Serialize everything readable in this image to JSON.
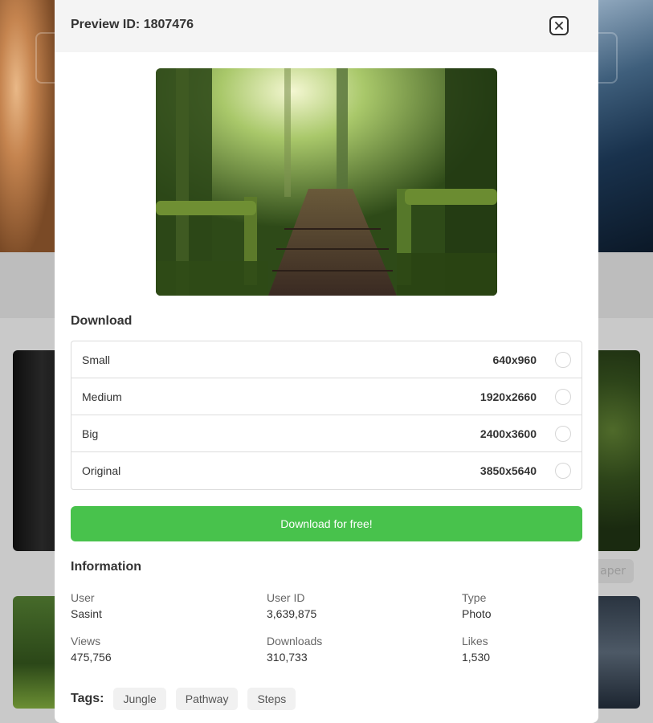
{
  "modal": {
    "title": "Preview ID: 1807476",
    "preview_alt": "Wooden moss-covered pathway through a jungle forest"
  },
  "download": {
    "title": "Download",
    "sizes": [
      {
        "name": "Small",
        "dimensions": "640x960"
      },
      {
        "name": "Medium",
        "dimensions": "1920x2660"
      },
      {
        "name": "Big",
        "dimensions": "2400x3600"
      },
      {
        "name": "Original",
        "dimensions": "3850x5640"
      }
    ],
    "button_label": "Download for free!",
    "button_color": "#48c24c"
  },
  "information": {
    "title": "Information",
    "fields": [
      {
        "label": "User",
        "value": "Sasint"
      },
      {
        "label": "User ID",
        "value": "3,639,875"
      },
      {
        "label": "Type",
        "value": "Photo"
      },
      {
        "label": "Views",
        "value": "475,756"
      },
      {
        "label": "Downloads",
        "value": "310,733"
      },
      {
        "label": "Likes",
        "value": "1,530"
      }
    ]
  },
  "tags": {
    "label": "Tags:",
    "items": [
      "Jungle",
      "Pathway",
      "Steps"
    ]
  },
  "background": {
    "partial_tag": "aper"
  },
  "icons": {
    "close": "close-icon"
  }
}
